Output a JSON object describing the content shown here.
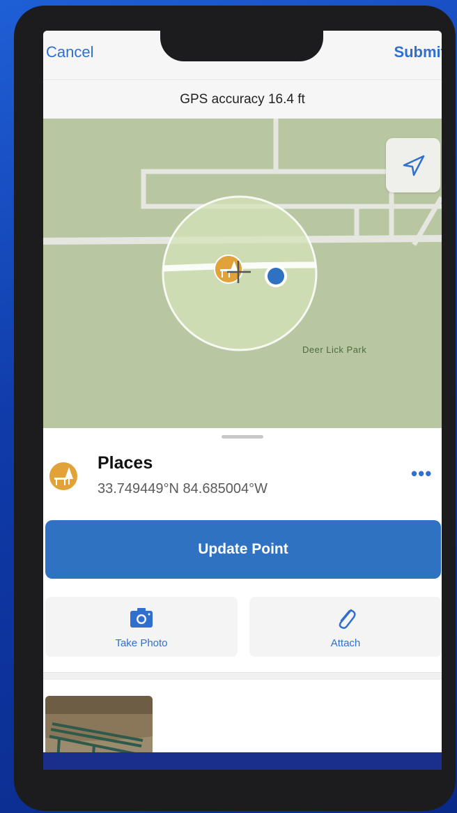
{
  "nav": {
    "cancel_label": "Cancel",
    "submit_label": "Submit"
  },
  "gps": {
    "text": "GPS accuracy 16.4 ft"
  },
  "map": {
    "park_label": "Deer Lick Park"
  },
  "place": {
    "title": "Places",
    "coords": "33.749449°N  84.685004°W",
    "more_label": "•••"
  },
  "actions": {
    "update_label": "Update Point",
    "take_photo_label": "Take Photo",
    "attach_label": "Attach"
  },
  "icons": {
    "locate": "location-arrow-icon",
    "place": "picnic-table-icon",
    "camera": "camera-icon",
    "attach": "paperclip-icon"
  },
  "colors": {
    "accent": "#2f6fcf",
    "button": "#2f72c2",
    "place_marker": "#e1a23a",
    "location_dot": "#2f72c2",
    "map_land": "#b9c6a2"
  }
}
